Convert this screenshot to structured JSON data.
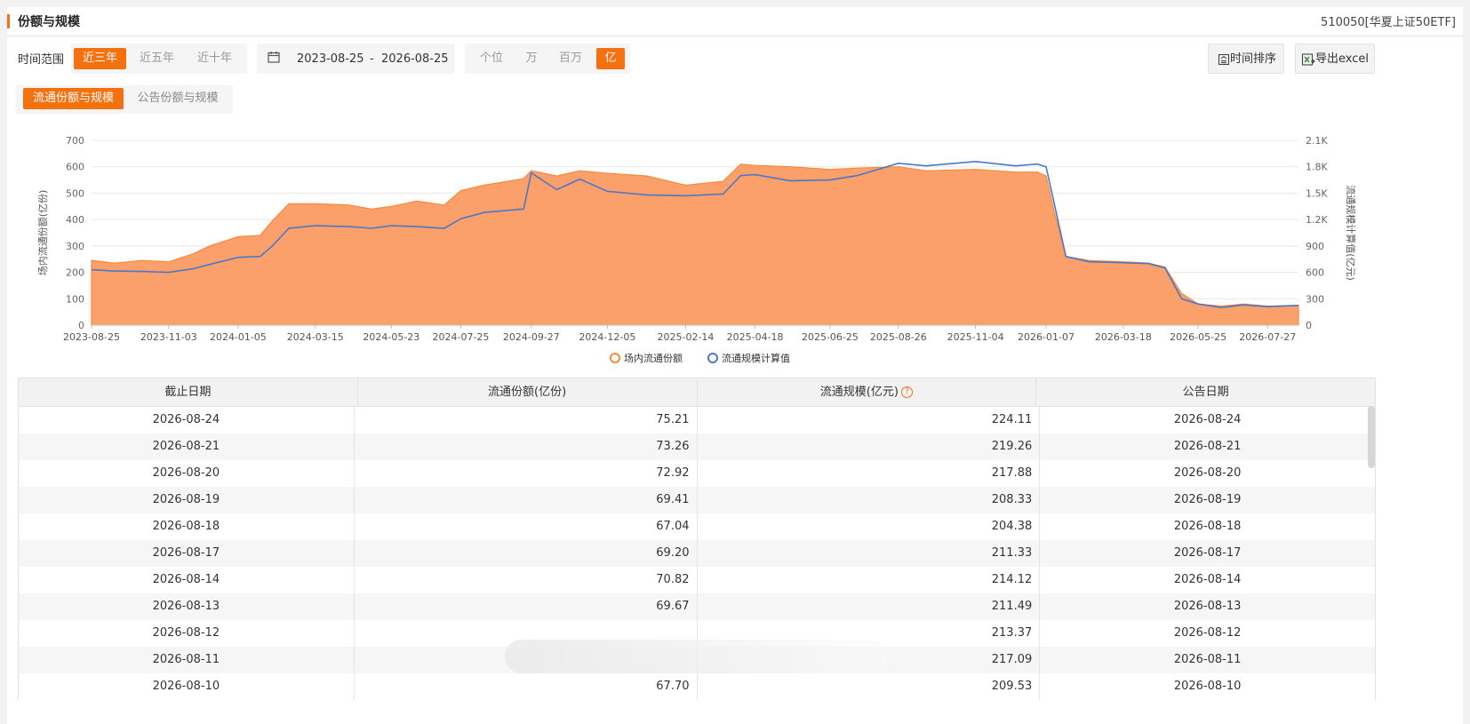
{
  "header": {
    "title": "份额与规模",
    "fund": "510050[华夏上证50ETF]"
  },
  "toolbar": {
    "range_label": "时间范围",
    "ranges": [
      "近三年",
      "近五年",
      "近十年"
    ],
    "range_active": 0,
    "date_start": "2023-08-25",
    "date_sep": "-",
    "date_end": "2026-08-25",
    "units": [
      "个位",
      "万",
      "百万",
      "亿"
    ],
    "unit_active": 3,
    "sort_label": "时间排序",
    "export_label": "导出excel"
  },
  "tabs": {
    "items": [
      "流通份额与规模",
      "公告份额与规模"
    ],
    "active": 0
  },
  "colors": {
    "accent": "#f5700f",
    "area_fill": "#fba06b",
    "area_stroke": "#f58a3a",
    "line": "#4a78c8"
  },
  "chart_data": {
    "type": "area",
    "ylabel_left": "场内流通份额(亿份)",
    "ylabel_right": "流通规模计算值(亿元)",
    "yticks_left": [
      "0",
      "100",
      "200",
      "300",
      "400",
      "500",
      "600",
      "700"
    ],
    "yticks_right": [
      "0",
      "300",
      "600",
      "900",
      "1.2K",
      "1.5K",
      "1.8K",
      "2.1K"
    ],
    "ylim_left": [
      0,
      700
    ],
    "ylim_right": [
      0,
      2100
    ],
    "xticks": [
      "2023-08-25",
      "2023-11-03",
      "2024-01-05",
      "2024-03-15",
      "2024-05-23",
      "2024-07-25",
      "2024-09-27",
      "2024-12-05",
      "2025-02-14",
      "2025-04-18",
      "2025-06-25",
      "2025-08-26",
      "2025-11-04",
      "2026-01-07",
      "2026-03-18",
      "2026-05-25",
      "2026-07-27"
    ],
    "legend": [
      "场内流通份额",
      "流通规模计算值"
    ],
    "legend_position": "bottom",
    "series": [
      {
        "name": "场内流通份额",
        "axis": "left",
        "points": [
          [
            "2023-08-25",
            245
          ],
          [
            "2023-09-15",
            235
          ],
          [
            "2023-10-10",
            245
          ],
          [
            "2023-11-03",
            240
          ],
          [
            "2023-11-25",
            270
          ],
          [
            "2023-12-10",
            300
          ],
          [
            "2024-01-05",
            335
          ],
          [
            "2024-01-25",
            340
          ],
          [
            "2024-02-05",
            395
          ],
          [
            "2024-02-20",
            460
          ],
          [
            "2024-03-15",
            460
          ],
          [
            "2024-04-15",
            455
          ],
          [
            "2024-05-05",
            440
          ],
          [
            "2024-05-23",
            450
          ],
          [
            "2024-06-15",
            470
          ],
          [
            "2024-07-10",
            455
          ],
          [
            "2024-07-25",
            510
          ],
          [
            "2024-08-15",
            530
          ],
          [
            "2024-09-20",
            555
          ],
          [
            "2024-09-27",
            585
          ],
          [
            "2024-10-20",
            565
          ],
          [
            "2024-11-10",
            585
          ],
          [
            "2024-12-05",
            575
          ],
          [
            "2025-01-10",
            565
          ],
          [
            "2025-02-14",
            530
          ],
          [
            "2025-03-20",
            545
          ],
          [
            "2025-04-05",
            610
          ],
          [
            "2025-04-18",
            605
          ],
          [
            "2025-05-20",
            600
          ],
          [
            "2025-06-25",
            590
          ],
          [
            "2025-07-20",
            595
          ],
          [
            "2025-08-26",
            600
          ],
          [
            "2025-09-20",
            585
          ],
          [
            "2025-11-04",
            590
          ],
          [
            "2025-12-10",
            580
          ],
          [
            "2025-12-30",
            580
          ],
          [
            "2026-01-07",
            565
          ],
          [
            "2026-01-15",
            420
          ],
          [
            "2026-01-25",
            260
          ],
          [
            "2026-02-15",
            245
          ],
          [
            "2026-03-18",
            240
          ],
          [
            "2026-04-10",
            235
          ],
          [
            "2026-04-25",
            220
          ],
          [
            "2026-05-10",
            120
          ],
          [
            "2026-05-25",
            80
          ],
          [
            "2026-06-15",
            72
          ],
          [
            "2026-07-05",
            80
          ],
          [
            "2026-07-27",
            72
          ],
          [
            "2026-08-24",
            75
          ]
        ]
      },
      {
        "name": "流通规模计算值",
        "axis": "right",
        "points": [
          [
            "2023-08-25",
            630
          ],
          [
            "2023-09-15",
            615
          ],
          [
            "2023-10-10",
            610
          ],
          [
            "2023-11-03",
            600
          ],
          [
            "2023-11-25",
            640
          ],
          [
            "2023-12-10",
            690
          ],
          [
            "2024-01-05",
            770
          ],
          [
            "2024-01-25",
            780
          ],
          [
            "2024-02-05",
            900
          ],
          [
            "2024-02-20",
            1100
          ],
          [
            "2024-03-15",
            1130
          ],
          [
            "2024-04-15",
            1120
          ],
          [
            "2024-05-05",
            1100
          ],
          [
            "2024-05-23",
            1130
          ],
          [
            "2024-06-15",
            1120
          ],
          [
            "2024-07-10",
            1100
          ],
          [
            "2024-07-25",
            1210
          ],
          [
            "2024-08-15",
            1280
          ],
          [
            "2024-09-20",
            1320
          ],
          [
            "2024-09-27",
            1730
          ],
          [
            "2024-10-20",
            1540
          ],
          [
            "2024-11-10",
            1660
          ],
          [
            "2024-12-05",
            1520
          ],
          [
            "2025-01-10",
            1480
          ],
          [
            "2025-02-14",
            1470
          ],
          [
            "2025-03-20",
            1490
          ],
          [
            "2025-04-05",
            1700
          ],
          [
            "2025-04-18",
            1710
          ],
          [
            "2025-05-20",
            1640
          ],
          [
            "2025-06-25",
            1650
          ],
          [
            "2025-07-20",
            1700
          ],
          [
            "2025-08-26",
            1840
          ],
          [
            "2025-09-20",
            1810
          ],
          [
            "2025-11-04",
            1860
          ],
          [
            "2025-12-10",
            1810
          ],
          [
            "2025-12-30",
            1830
          ],
          [
            "2026-01-07",
            1800
          ],
          [
            "2026-01-15",
            1350
          ],
          [
            "2026-01-25",
            780
          ],
          [
            "2026-02-15",
            720
          ],
          [
            "2026-03-18",
            710
          ],
          [
            "2026-04-10",
            700
          ],
          [
            "2026-04-25",
            650
          ],
          [
            "2026-05-10",
            300
          ],
          [
            "2026-05-25",
            240
          ],
          [
            "2026-06-15",
            200
          ],
          [
            "2026-07-05",
            230
          ],
          [
            "2026-07-27",
            210
          ],
          [
            "2026-08-24",
            224
          ]
        ]
      }
    ]
  },
  "table": {
    "columns": [
      "截止日期",
      "流通份额(亿份)",
      "流通规模(亿元)",
      "公告日期"
    ],
    "rows": [
      [
        "2026-08-24",
        "75.21",
        "224.11",
        "2026-08-24"
      ],
      [
        "2026-08-21",
        "73.26",
        "219.26",
        "2026-08-21"
      ],
      [
        "2026-08-20",
        "72.92",
        "217.88",
        "2026-08-20"
      ],
      [
        "2026-08-19",
        "69.41",
        "208.33",
        "2026-08-19"
      ],
      [
        "2026-08-18",
        "67.04",
        "204.38",
        "2026-08-18"
      ],
      [
        "2026-08-17",
        "69.20",
        "211.33",
        "2026-08-17"
      ],
      [
        "2026-08-14",
        "70.82",
        "214.12",
        "2026-08-14"
      ],
      [
        "2026-08-13",
        "69.67",
        "211.49",
        "2026-08-13"
      ],
      [
        "2026-08-12",
        "",
        "213.37",
        "2026-08-12"
      ],
      [
        "2026-08-11",
        "",
        "217.09",
        "2026-08-11"
      ],
      [
        "2026-08-10",
        "67.70",
        "209.53",
        "2026-08-10"
      ]
    ]
  }
}
